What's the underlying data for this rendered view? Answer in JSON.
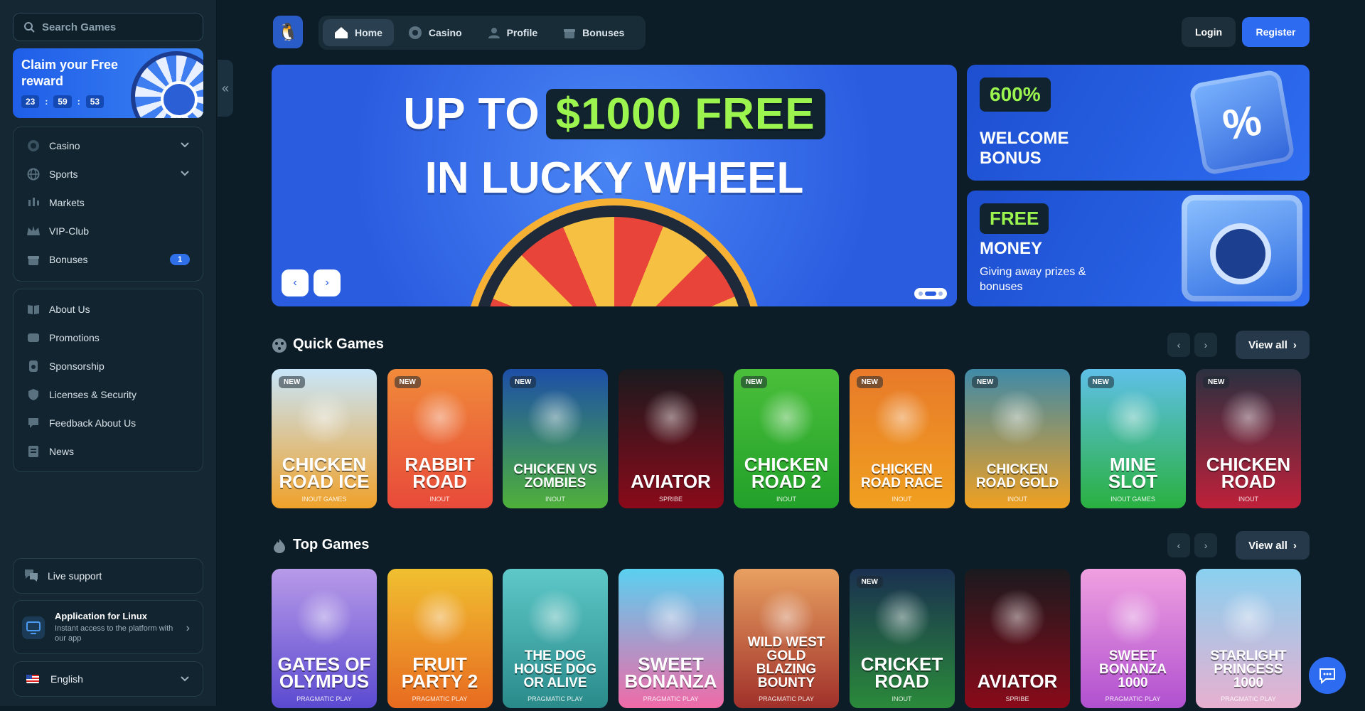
{
  "sidebar": {
    "search_placeholder": "Search Games",
    "reward": {
      "title": "Claim your Free reward",
      "hours": "23",
      "minutes": "59",
      "seconds": "53",
      "sep": ":"
    },
    "nav_primary": [
      {
        "label": "Casino",
        "icon": "casino-chip-icon",
        "has_chevron": true
      },
      {
        "label": "Sports",
        "icon": "globe-icon",
        "has_chevron": true
      },
      {
        "label": "Markets",
        "icon": "candlestick-icon"
      },
      {
        "label": "VIP-Club",
        "icon": "crown-icon"
      },
      {
        "label": "Bonuses",
        "icon": "gift-icon",
        "badge": "1"
      }
    ],
    "nav_secondary": [
      {
        "label": "About Us",
        "icon": "book-icon"
      },
      {
        "label": "Promotions",
        "icon": "ticket-icon"
      },
      {
        "label": "Sponsorship",
        "icon": "medal-icon"
      },
      {
        "label": "Licenses & Security",
        "icon": "shield-icon"
      },
      {
        "label": "Feedback About Us",
        "icon": "chat-icon"
      },
      {
        "label": "News",
        "icon": "newspaper-icon"
      }
    ],
    "support_label": "Live support",
    "app": {
      "title": "Application for Linux",
      "desc": "Instant access to the platform with our app"
    },
    "language": "English"
  },
  "header": {
    "nav": [
      {
        "label": "Home",
        "icon": "home-icon",
        "active": true
      },
      {
        "label": "Casino",
        "icon": "casino-chip-icon"
      },
      {
        "label": "Profile",
        "icon": "user-icon"
      },
      {
        "label": "Bonuses",
        "icon": "gift-icon"
      }
    ],
    "login": "Login",
    "register": "Register"
  },
  "hero": {
    "line1_a": "UP TO",
    "line1_b": "$1000 FREE",
    "line2": "IN LUCKY WHEEL",
    "slide": 2,
    "slide_count": 3
  },
  "promos": [
    {
      "tag": "600%",
      "title": "WELCOME BONUS",
      "subtitle": ""
    },
    {
      "tag": "FREE",
      "title": "MONEY",
      "subtitle": "Giving away prizes & bonuses"
    }
  ],
  "quick_games": {
    "title": "Quick Games",
    "view_all": "View all",
    "games": [
      {
        "title": "CHICKEN ROAD ICE",
        "provider": "INOUT GAMES",
        "new": true,
        "color": "#c8e6fa",
        "color2": "#f0a12a"
      },
      {
        "title": "RABBIT ROAD",
        "provider": "INOUT",
        "new": true,
        "color": "#f08a3a",
        "color2": "#e84a3a"
      },
      {
        "title": "CHICKEN VS ZOMBIES",
        "provider": "INOUT",
        "new": true,
        "color": "#1d4fa8",
        "color2": "#4fb03a"
      },
      {
        "title": "AVIATOR",
        "provider": "SPRIBE",
        "new": false,
        "color": "#1a1a1e",
        "color2": "#8a0a1a"
      },
      {
        "title": "CHICKEN ROAD 2",
        "provider": "INOUT",
        "new": true,
        "color": "#4abf3a",
        "color2": "#22a02a"
      },
      {
        "title": "CHICKEN ROAD RACE",
        "provider": "INOUT",
        "new": true,
        "color": "#e87a2a",
        "color2": "#f0a020"
      },
      {
        "title": "CHICKEN ROAD GOLD",
        "provider": "INOUT",
        "new": true,
        "color": "#3f8aa8",
        "color2": "#f0a020"
      },
      {
        "title": "MINE SLOT",
        "provider": "INOUT GAMES",
        "new": true,
        "color": "#5ec0e8",
        "color2": "#2ab040"
      },
      {
        "title": "CHICKEN ROAD",
        "provider": "INOUT",
        "new": true,
        "color": "#2a3040",
        "color2": "#c0203a"
      }
    ]
  },
  "top_games": {
    "title": "Top Games",
    "view_all": "View all",
    "games": [
      {
        "title": "GATES OF OLYMPUS",
        "provider": "PRAGMATIC PLAY",
        "new": false,
        "color": "#b89ae8",
        "color2": "#5a4ad0"
      },
      {
        "title": "FRUIT PARTY 2",
        "provider": "PRAGMATIC PLAY",
        "new": false,
        "color": "#f0c030",
        "color2": "#e86a20"
      },
      {
        "title": "THE DOG HOUSE DOG OR ALIVE",
        "provider": "PRAGMATIC PLAY",
        "new": false,
        "color": "#5ec8c8",
        "color2": "#2a8a8a"
      },
      {
        "title": "SWEET BONANZA",
        "provider": "PRAGMATIC PLAY",
        "new": false,
        "color": "#5ad0f0",
        "color2": "#f06aa8"
      },
      {
        "title": "WILD WEST GOLD BLAZING BOUNTY",
        "provider": "PRAGMATIC PLAY",
        "new": false,
        "color": "#e8a060",
        "color2": "#a0302a"
      },
      {
        "title": "CRICKET ROAD",
        "provider": "INOUT",
        "new": true,
        "color": "#1a3050",
        "color2": "#2a8a3a"
      },
      {
        "title": "AVIATOR",
        "provider": "SPRIBE",
        "new": false,
        "color": "#1a1a1e",
        "color2": "#8a0a1a"
      },
      {
        "title": "SWEET BONANZA 1000",
        "provider": "PRAGMATIC PLAY",
        "new": false,
        "color": "#f0a0e0",
        "color2": "#b050d0"
      },
      {
        "title": "STARLIGHT PRINCESS 1000",
        "provider": "PRAGMATIC PLAY",
        "new": false,
        "color": "#8ad0f0",
        "color2": "#e8b0d0"
      }
    ]
  },
  "new_label": "NEW",
  "colors": {
    "accent": "#2d6cf0",
    "highlight": "#9cf54f",
    "bg": "#0d1d27",
    "sidebar": "#142733"
  }
}
